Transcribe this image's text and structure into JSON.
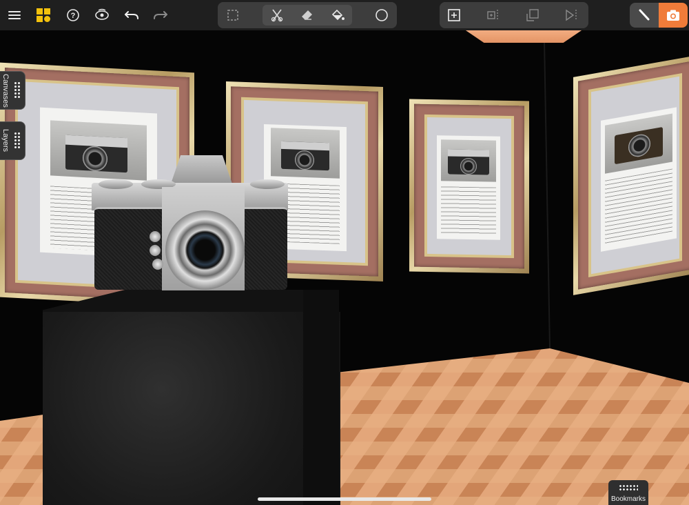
{
  "toolbar": {
    "left": [
      "menu-icon",
      "gallery-icon",
      "help-icon",
      "view-icon",
      "undo-icon",
      "redo-icon"
    ],
    "tools": [
      "selection-icon",
      "cut-icon",
      "eraser-icon",
      "fill-icon",
      "shape-icon"
    ],
    "transform": [
      "add-plane-icon",
      "align-icon",
      "move-icon",
      "mirror-icon"
    ],
    "modes": [
      "brush-icon",
      "camera-icon"
    ],
    "accent": "#f07c3a",
    "logo_color": "#f4c20d"
  },
  "sidebar": {
    "canvases": "Canvases",
    "layers": "Layers"
  },
  "bookmarks": {
    "label": "Bookmarks"
  }
}
